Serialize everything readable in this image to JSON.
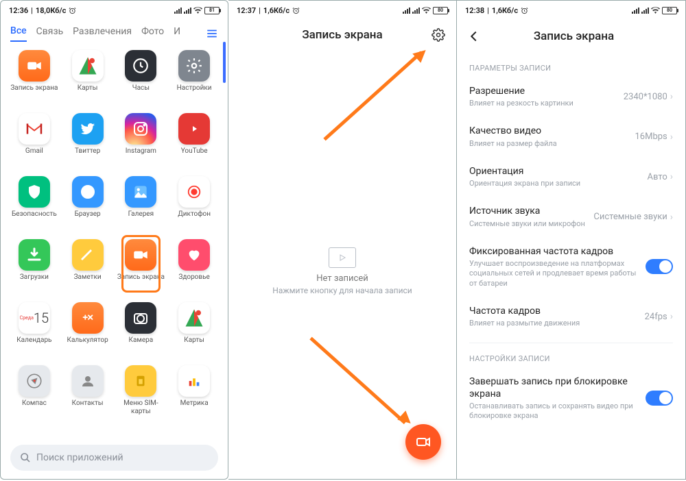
{
  "s1": {
    "status": {
      "time": "12:36",
      "net": "18,0Кб/с",
      "bat": "81"
    },
    "tabs": [
      "Все",
      "Связь",
      "Развлечения",
      "Фото",
      "И"
    ],
    "ham_icon": "menu-icon",
    "apps": [
      {
        "label": "Запись экрана",
        "icon": "video-icon",
        "bg": "bg-orange"
      },
      {
        "label": "Карты",
        "icon": "gmaps-icon",
        "bg": "bg-white"
      },
      {
        "label": "Часы",
        "icon": "clock-icon",
        "bg": "bg-dark"
      },
      {
        "label": "Настройки",
        "icon": "gear-icon",
        "bg": "bg-grey"
      },
      {
        "label": "Gmail",
        "icon": "gmail-icon",
        "bg": "bg-white"
      },
      {
        "label": "Твиттер",
        "icon": "twitter-icon",
        "bg": "bg-twitter"
      },
      {
        "label": "Instagram",
        "icon": "instagram-icon",
        "bg": "bg-insta"
      },
      {
        "label": "YouTube",
        "icon": "youtube-icon",
        "bg": "bg-yt"
      },
      {
        "label": "Безопасность",
        "icon": "shield-icon",
        "bg": "bg-teal"
      },
      {
        "label": "Браузер",
        "icon": "globe-icon",
        "bg": "bg-blue"
      },
      {
        "label": "Галерея",
        "icon": "gallery-icon",
        "bg": "bg-blue"
      },
      {
        "label": "Диктофон",
        "icon": "record-icon",
        "bg": "bg-white"
      },
      {
        "label": "Загрузки",
        "icon": "download-icon",
        "bg": "bg-green"
      },
      {
        "label": "Заметки",
        "icon": "notes-icon",
        "bg": "bg-yellow"
      },
      {
        "label": "Запись экрана",
        "icon": "video-icon",
        "bg": "bg-orange",
        "hl": true
      },
      {
        "label": "Здоровье",
        "icon": "heart-icon",
        "bg": "bg-pink"
      },
      {
        "label": "Календарь",
        "icon": "calendar-icon",
        "bg": "bg-white",
        "extra": "15",
        "top": "Среда"
      },
      {
        "label": "Калькулятор",
        "icon": "calc-icon",
        "bg": "bg-orange"
      },
      {
        "label": "Камера",
        "icon": "camera-icon",
        "bg": "bg-dark"
      },
      {
        "label": "Карты",
        "icon": "gmaps-icon",
        "bg": "bg-white"
      },
      {
        "label": "Компас",
        "icon": "compass-icon",
        "bg": "bg-lgrey"
      },
      {
        "label": "Контакты",
        "icon": "contacts-icon",
        "bg": "bg-lgrey"
      },
      {
        "label": "Меню SIM-карты",
        "icon": "sim-icon",
        "bg": "bg-yellow"
      },
      {
        "label": "Метрика",
        "icon": "chart-icon",
        "bg": "bg-white"
      }
    ],
    "search_placeholder": "Поиск приложений"
  },
  "s2": {
    "status": {
      "time": "12:37",
      "net": "1,6Кб/с",
      "bat": "80"
    },
    "title": "Запись экрана",
    "empty_title": "Нет записей",
    "empty_sub": "Нажмите кнопку для начала записи"
  },
  "s3": {
    "status": {
      "time": "12:38",
      "net": "1,6Кб/с",
      "bat": "80"
    },
    "title": "Запись экрана",
    "sect1": "ПАРАМЕТРЫ ЗАПИСИ",
    "rows1": [
      {
        "t": "Разрешение",
        "s": "Влияет на резкость картинки",
        "v": "2340*1080"
      },
      {
        "t": "Качество видео",
        "s": "Влияет на размер файла",
        "v": "16Mbps"
      },
      {
        "t": "Ориентация",
        "s": "Ориентация экрана при записи",
        "v": "Авто"
      },
      {
        "t": "Источник звука",
        "s": "Системные звуки или микрофон",
        "v": "Системные звуки"
      }
    ],
    "row_fixed": {
      "t": "Фиксированная частота кадров",
      "s": "Улучшает воспроизведение на платформах социальных сетей и продлевает время работы от батареи"
    },
    "row_fps": {
      "t": "Частота кадров",
      "s": "Влияет на размытие движения",
      "v": "24fps"
    },
    "sect2": "НАСТРОЙКИ ЗАПИСИ",
    "row_lock": {
      "t": "Завершать запись при блокировке экрана",
      "s": "Останавливать запись и сохранять видео при блокировке экрана"
    }
  }
}
